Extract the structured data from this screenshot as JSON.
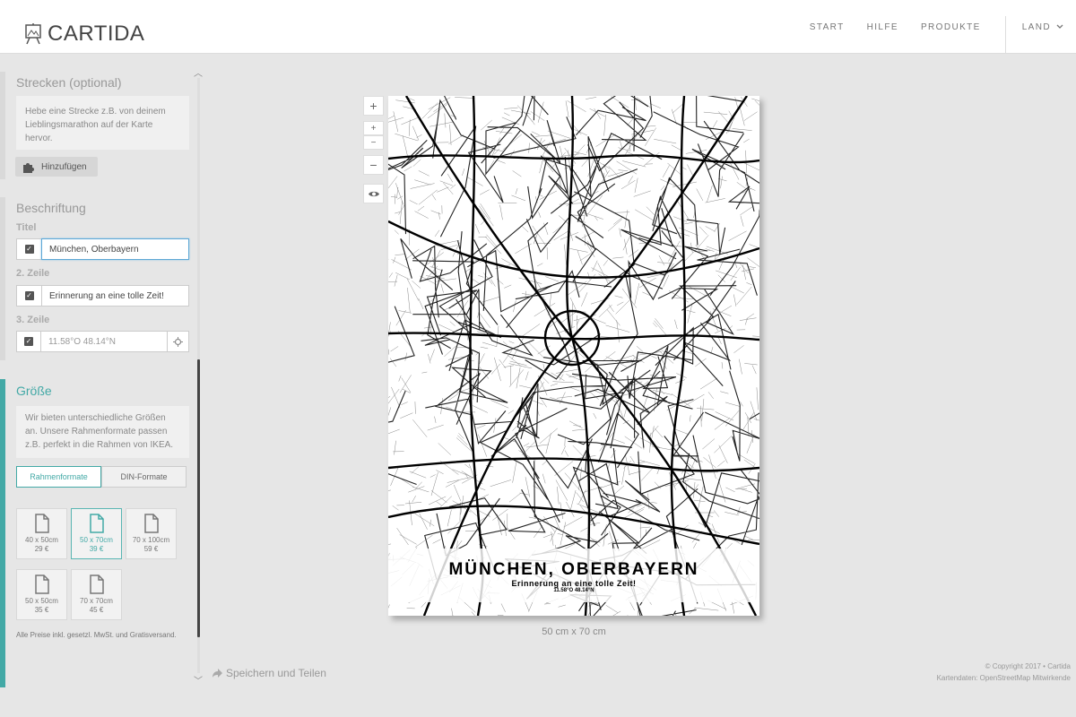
{
  "header": {
    "logo_text": "CARTIDA",
    "nav": [
      "START",
      "HILFE",
      "PRODUKTE"
    ],
    "land": "LAND"
  },
  "sections": {
    "strecken": {
      "title": "Strecken (optional)",
      "info": "Hebe eine Strecke z.B. von deinem Lieblingsmarathon auf der Karte hervor.",
      "add_button": "Hinzufügen"
    },
    "beschriftung": {
      "title": "Beschriftung",
      "line1_label": "Titel",
      "line1_value": "München, Oberbayern",
      "line2_label": "2. Zeile",
      "line2_value": "Erinnerung an eine tolle Zeit!",
      "line3_label": "3. Zeile",
      "line3_value": "11.58°O 48.14°N"
    },
    "groesse": {
      "title": "Größe",
      "info": "Wir bieten unterschiedliche Größen an. Unsere Rahmenformate passen z.B. perfekt in die Rahmen von IKEA.",
      "tabs": [
        "Rahmenformate",
        "DIN-Formate"
      ],
      "sizes": [
        {
          "dim": "40 x 50cm",
          "price": "29 €"
        },
        {
          "dim": "50 x 70cm",
          "price": "39 €"
        },
        {
          "dim": "70 x 100cm",
          "price": "59 €"
        },
        {
          "dim": "50 x 50cm",
          "price": "35 €"
        },
        {
          "dim": "70 x 70cm",
          "price": "45 €"
        }
      ],
      "note": "Alle Preise inkl. gesetzl. MwSt. und Gratisversand."
    }
  },
  "save_share": "Speichern und Teilen",
  "poster": {
    "title": "MÜNCHEN, OBERBAYERN",
    "subtitle": "Erinnerung an eine tolle Zeit!",
    "coords": "11.58°O 48.14°N",
    "size_caption": "50 cm x 70 cm"
  },
  "footer": {
    "copyright": "© Copyright 2017 • Cartida",
    "map_data": "Kartendaten: OpenStreetMap Mitwirkende"
  },
  "colors": {
    "accent": "#43a9a6",
    "focus": "#5da8d6"
  }
}
